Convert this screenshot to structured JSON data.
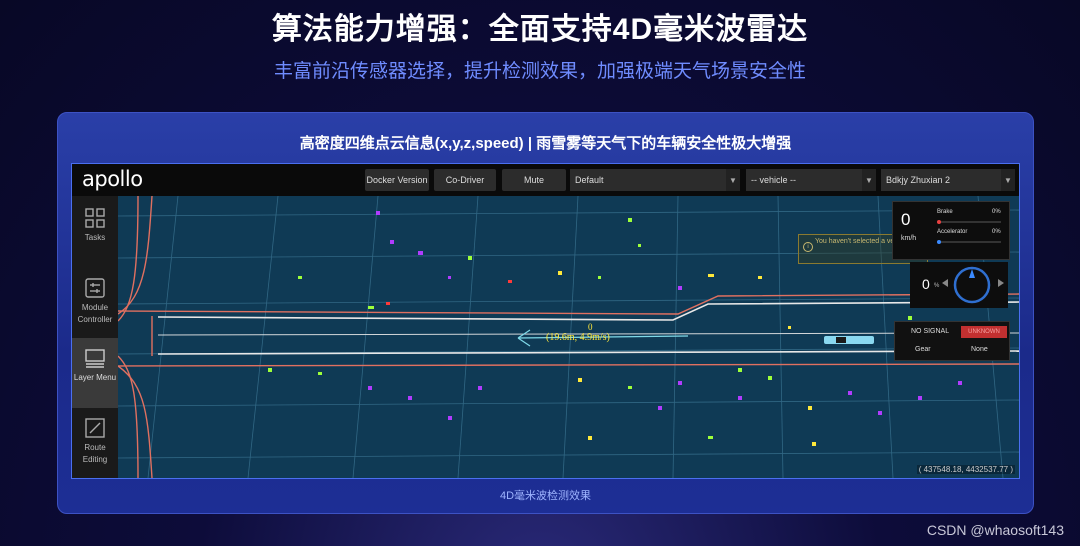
{
  "slide": {
    "title": "算法能力增强：全面支持4D毫米波雷达",
    "subtitle": "丰富前沿传感器选择，提升检测效果，加强极端天气场景安全性",
    "card_title": "高密度四维点云信息(x,y,z,speed) | 雨雪雾等天气下的车辆安全性极大增强",
    "caption": "4D毫米波检测效果",
    "watermark": "CSDN @whaosoft143"
  },
  "app": {
    "logo": "apollo",
    "toolbar": {
      "docker_version": "Docker Version",
      "co_driver": "Co-Driver",
      "mute": "Mute",
      "mode_select": "Default",
      "vehicle_select": "-- vehicle --",
      "map_select": "Bdkjy Zhuxian 2"
    },
    "sidebar": [
      {
        "label": "Tasks",
        "icon": "grid-icon"
      },
      {
        "label": "Module Controller",
        "icon": "module-controller-icon"
      },
      {
        "label": "Layer Menu",
        "icon": "layer-menu-icon"
      },
      {
        "label": "Route Editing",
        "icon": "route-editing-icon"
      }
    ],
    "alert_text": "You haven't selected a vehicle yet!",
    "dashboard": {
      "speed": "0",
      "speed_unit": "km/h",
      "brake_label": "Brake",
      "brake_value": "0%",
      "accel_label": "Accelerator",
      "accel_value": "0%",
      "steering": "0",
      "steering_unit": "%",
      "signal": "NO SIGNAL",
      "status": "UNKNOWN",
      "gear_label": "Gear",
      "gear_value": "None"
    },
    "obstacle_label_id": "0",
    "obstacle_label_speed": "(19.6m, 4.9m/s)",
    "coordinates": "( 437548.18, 4432537.77 )",
    "colors": {
      "lane": "#e8e8e8",
      "boundary": "#e07060",
      "radar_points": [
        "#b03cff",
        "#9dff3a",
        "#ffe83a",
        "#ff3a3a"
      ]
    }
  }
}
